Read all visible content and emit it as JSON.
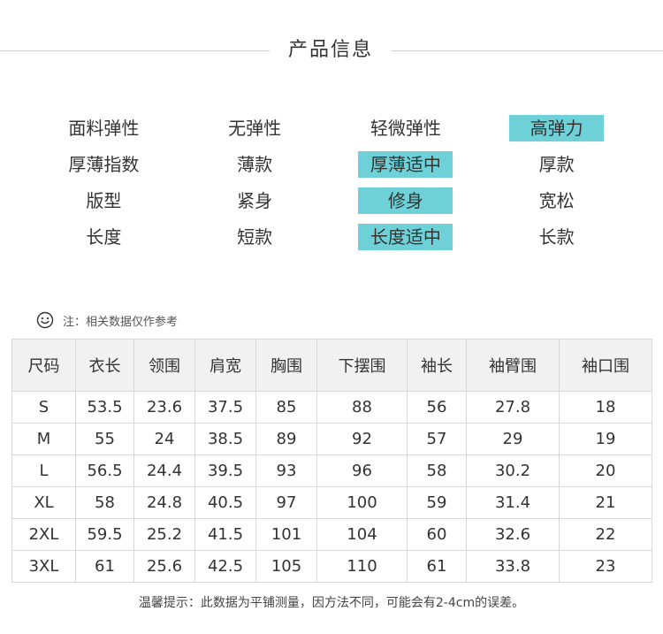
{
  "header": {
    "title": "产品信息"
  },
  "attributes": [
    {
      "label": "面料弹性",
      "options": [
        "无弹性",
        "轻微弹性",
        "高弹力"
      ],
      "selected": 2
    },
    {
      "label": "厚薄指数",
      "options": [
        "薄款",
        "厚薄适中",
        "厚款"
      ],
      "selected": 1
    },
    {
      "label": "版型",
      "options": [
        "紧身",
        "修身",
        "宽松"
      ],
      "selected": 1
    },
    {
      "label": "长度",
      "options": [
        "短款",
        "长度适中",
        "长款"
      ],
      "selected": 1
    }
  ],
  "highlight_color": "#6dd1d7",
  "note": {
    "icon": "smiley-icon",
    "text": "注：相关数据仅作参考"
  },
  "size_table": {
    "headers": [
      "尺码",
      "衣长",
      "领围",
      "肩宽",
      "胸围",
      "下摆围",
      "袖长",
      "袖臂围",
      "袖口围"
    ],
    "rows": [
      [
        "S",
        "53.5",
        "23.6",
        "37.5",
        "85",
        "88",
        "56",
        "27.8",
        "18"
      ],
      [
        "M",
        "55",
        "24",
        "38.5",
        "89",
        "92",
        "57",
        "29",
        "19"
      ],
      [
        "L",
        "56.5",
        "24.4",
        "39.5",
        "93",
        "96",
        "58",
        "30.2",
        "20"
      ],
      [
        "XL",
        "58",
        "24.8",
        "40.5",
        "97",
        "100",
        "59",
        "31.4",
        "21"
      ],
      [
        "2XL",
        "59.5",
        "25.2",
        "41.5",
        "101",
        "104",
        "60",
        "32.6",
        "22"
      ],
      [
        "3XL",
        "61",
        "25.6",
        "42.5",
        "105",
        "110",
        "61",
        "33.8",
        "23"
      ]
    ]
  },
  "footer": {
    "text": "温馨提示：此数据为平铺测量，因方法不同，可能会有2-4cm的误差。"
  }
}
